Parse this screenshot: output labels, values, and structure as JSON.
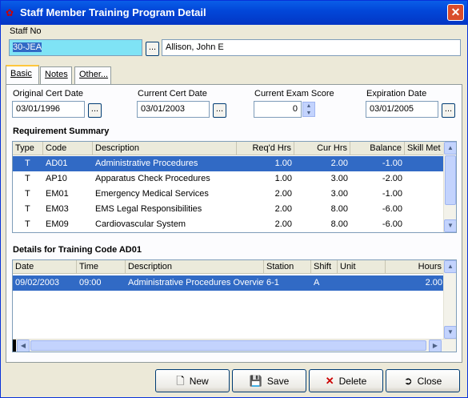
{
  "window": {
    "title": "Staff Member Training Program Detail",
    "close_glyph": "✕"
  },
  "staff": {
    "label": "Staff No",
    "number": "30-JEA",
    "name": "Allison, John E",
    "lookup_glyph": "..."
  },
  "tabs": [
    {
      "label": "Basic"
    },
    {
      "label": "Notes"
    },
    {
      "label": "Other..."
    }
  ],
  "basic": {
    "original_cert_label": "Original Cert Date",
    "original_cert_value": "03/01/1996",
    "current_cert_label": "Current Cert Date",
    "current_cert_value": "03/01/2003",
    "exam_score_label": "Current Exam Score",
    "exam_score_value": "0",
    "expiration_label": "Expiration Date",
    "expiration_value": "03/01/2005",
    "picker_glyph": "..."
  },
  "requirements": {
    "title": "Requirement Summary",
    "columns": [
      "Type",
      "Code",
      "Description",
      "Req'd Hrs",
      "Cur Hrs",
      "Balance",
      "Skill Met"
    ],
    "rows": [
      {
        "type": "T",
        "code": "AD01",
        "description": "Administrative Procedures",
        "reqd": "1.00",
        "cur": "2.00",
        "balance": "-1.00",
        "skill": ""
      },
      {
        "type": "T",
        "code": "AP10",
        "description": "Apparatus Check Procedures",
        "reqd": "1.00",
        "cur": "3.00",
        "balance": "-2.00",
        "skill": ""
      },
      {
        "type": "T",
        "code": "EM01",
        "description": "Emergency Medical Services",
        "reqd": "2.00",
        "cur": "3.00",
        "balance": "-1.00",
        "skill": ""
      },
      {
        "type": "T",
        "code": "EM03",
        "description": "EMS Legal Responsibilities",
        "reqd": "2.00",
        "cur": "8.00",
        "balance": "-6.00",
        "skill": ""
      },
      {
        "type": "T",
        "code": "EM09",
        "description": "Cardiovascular System",
        "reqd": "2.00",
        "cur": "8.00",
        "balance": "-6.00",
        "skill": ""
      }
    ]
  },
  "details": {
    "title": "Details for Training Code AD01",
    "columns": [
      "Date",
      "Time",
      "Description",
      "Station",
      "Shift",
      "Unit",
      "Hours"
    ],
    "rows": [
      {
        "date": "09/02/2003",
        "time": "09:00",
        "description": "Administrative Procedures Overview",
        "station": "6-1",
        "shift": "A",
        "unit": "",
        "hours": "2.00"
      }
    ]
  },
  "buttons": {
    "new": "New",
    "save": "Save",
    "delete": "Delete",
    "close": "Close"
  }
}
